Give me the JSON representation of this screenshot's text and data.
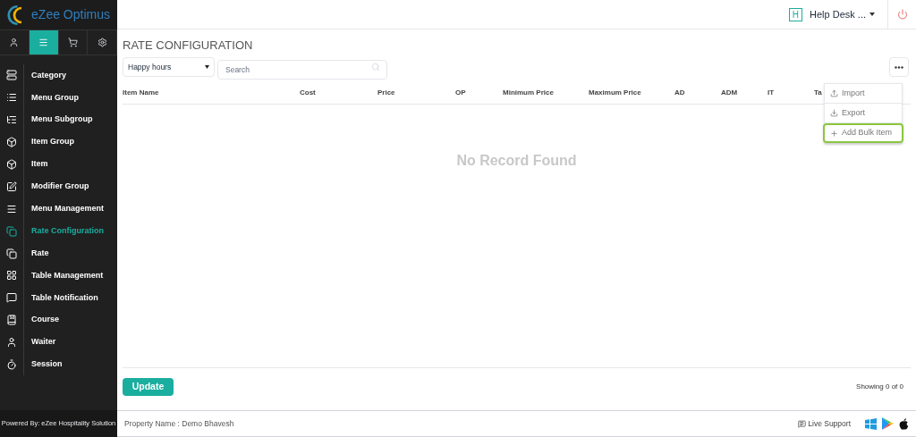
{
  "logo": {
    "text": "eZee Optimus"
  },
  "sidebar_tabs": [
    {
      "kind": "user",
      "selected": false
    },
    {
      "kind": "menu",
      "selected": true
    },
    {
      "kind": "cart",
      "selected": false
    },
    {
      "kind": "settings",
      "selected": false
    }
  ],
  "sidebar": {
    "items": [
      {
        "label": "Category",
        "selected": false
      },
      {
        "label": "Menu Group",
        "selected": false
      },
      {
        "label": "Menu Subgroup",
        "selected": false
      },
      {
        "label": "Item Group",
        "selected": false
      },
      {
        "label": "Item",
        "selected": false
      },
      {
        "label": "Modifier Group",
        "selected": false
      },
      {
        "label": "Menu Management",
        "selected": false
      },
      {
        "label": "Rate Configuration",
        "selected": true
      },
      {
        "label": "Rate",
        "selected": false
      },
      {
        "label": "Table Management",
        "selected": false
      },
      {
        "label": "Table Notification",
        "selected": false
      },
      {
        "label": "Course",
        "selected": false
      },
      {
        "label": "Waiter",
        "selected": false
      },
      {
        "label": "Session",
        "selected": false
      }
    ],
    "footer": "Powered By: eZee Hospitality Solution"
  },
  "header": {
    "badge": "H",
    "user": "Help Desk ..."
  },
  "page": {
    "title": "RATE CONFIGURATION",
    "filter": "Happy hours",
    "search": {
      "placeholder": "Search"
    }
  },
  "table": {
    "columns": [
      "Item Name",
      "Cost",
      "Price",
      "OP",
      "Minimum Price",
      "Maximum Price",
      "AD",
      "ADM",
      "IT",
      "Ta"
    ],
    "empty": "No Record Found"
  },
  "menu": {
    "items": [
      {
        "label": "Import",
        "highlighted": false
      },
      {
        "label": "Export",
        "highlighted": false
      },
      {
        "label": "Add Bulk Item",
        "highlighted": true
      }
    ]
  },
  "update_button": "Update",
  "showing": "Showing 0 of 0",
  "status_bar": {
    "property": "Property Name : Demo Bhavesh",
    "support": "Live Support"
  }
}
